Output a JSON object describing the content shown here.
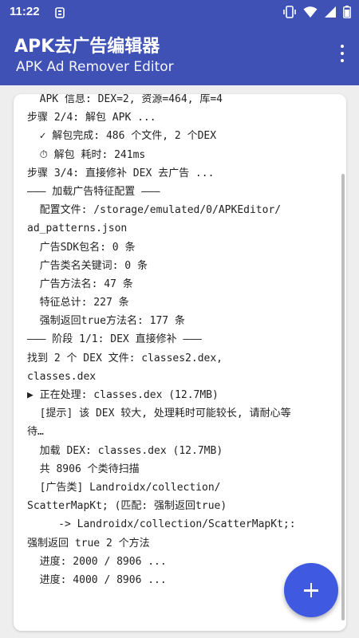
{
  "status_bar": {
    "time": "11:22",
    "notif_icon": "app-notification-icon",
    "icons": [
      "vibrate-icon",
      "wifi-icon",
      "signal-icon",
      "battery-icon"
    ]
  },
  "app_bar": {
    "title": "APK去广告编辑器",
    "subtitle": "APK Ad Remover Editor",
    "overflow_icon": "more-vert-icon",
    "color": "#3f51b5"
  },
  "log": {
    "lines": [
      "  APK 信息: DEX=2, 资源=464, 库=4",
      "步骤 2/4: 解包 APK ...",
      "  ✓ 解包完成: 486 个文件, 2 个DEX",
      "  ⏱ 解包 耗时: 241ms",
      "步骤 3/4: 直接修补 DEX 去广告 ...",
      "——— 加载广告特征配置 ———",
      "  配置文件: /storage/emulated/0/APKEditor/",
      "ad_patterns.json",
      "  广告SDK包名: 0 条",
      "  广告类名关键词: 0 条",
      "  广告方法名: 47 条",
      "  特征总计: 227 条",
      "  强制返回true方法名: 177 条",
      "——— 阶段 1/1: DEX 直接修补 ———",
      "找到 2 个 DEX 文件: classes2.dex,",
      "classes.dex",
      "▶ 正在处理: classes.dex (12.7MB)",
      "  [提示] 该 DEX 较大, 处理耗时可能较长, 请耐心等",
      "待…",
      "  加载 DEX: classes.dex (12.7MB)",
      "  共 8906 个类待扫描",
      "  [广告类] Landroidx/collection/",
      "ScatterMapKt; (匹配: 强制返回true)",
      "     -> Landroidx/collection/ScatterMapKt;:",
      "强制返回 true 2 个方法",
      "  进度: 2000 / 8906 ...",
      "  进度: 4000 / 8906 ..."
    ]
  },
  "fab": {
    "icon": "plus-icon",
    "color": "#3f5ae0"
  }
}
